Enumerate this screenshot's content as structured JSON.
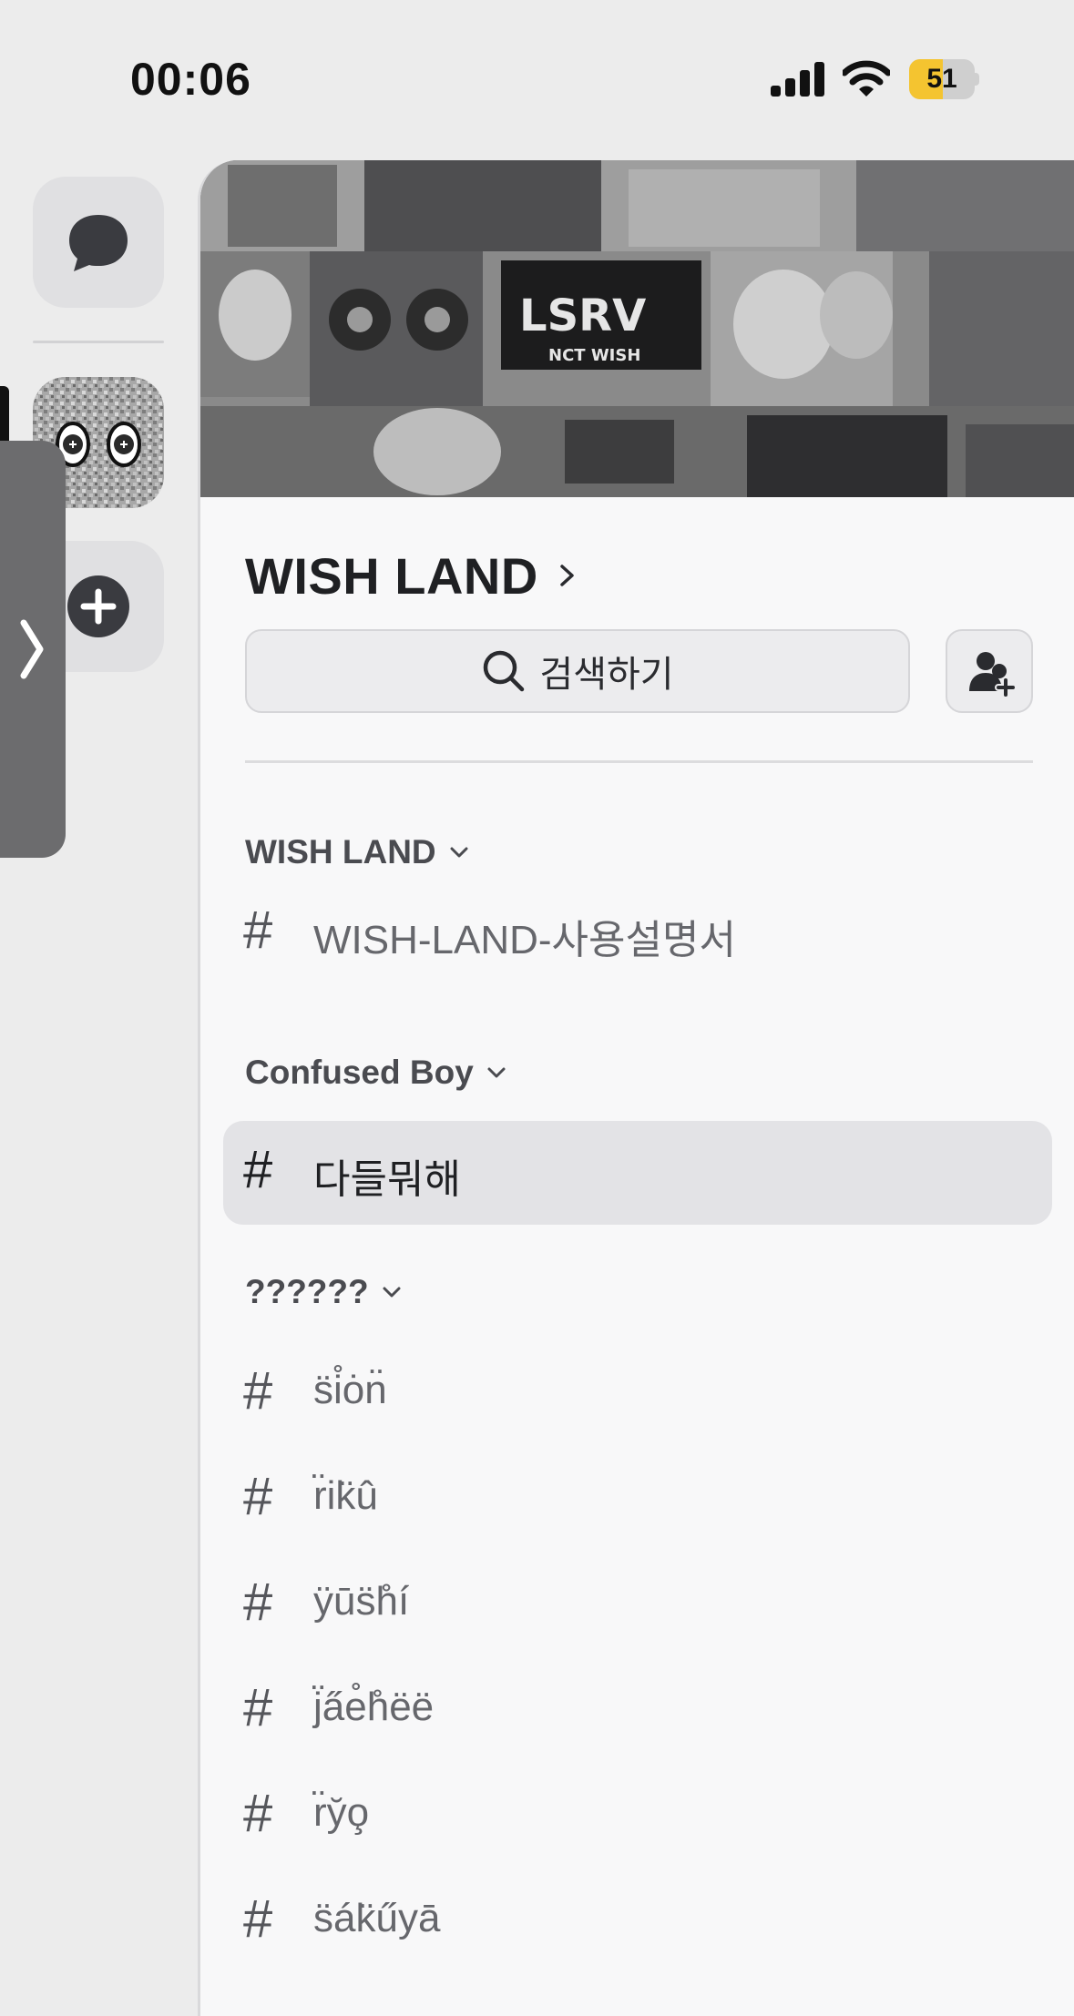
{
  "status_bar": {
    "time": "00:06",
    "battery_percent": "51",
    "battery_level": 0.51
  },
  "rail": {
    "dm_icon": "chat-bubble-icon",
    "server_icon": "server-avatar-icon",
    "add_icon": "plus-circle-icon",
    "collapse_icon": "chevron-right-icon"
  },
  "server": {
    "name": "WISH LAND",
    "banner_text": "NCT WISH"
  },
  "search": {
    "label": "검색하기"
  },
  "categories": [
    {
      "label": "WISH LAND",
      "channels": [
        {
          "name": "WISH-LAND-사용설명서"
        }
      ]
    },
    {
      "label": "Confused Boy",
      "channels": [
        {
          "name": "다들뭐해"
        }
      ]
    },
    {
      "label": "??????",
      "channels": [
        {
          "name": "s̈i̊ȯn̈"
        },
        {
          "name": "r̈ik̈û"
        },
        {
          "name": "ÿūs̈h̊í"
        },
        {
          "name": "j̈a̋e̊h̊ëë"
        },
        {
          "name": "r̈y̆o̧"
        },
        {
          "name": "s̈ák̈űyā"
        }
      ]
    }
  ],
  "hash_symbol": "#",
  "colors": {
    "accent_battery": "#f4c430",
    "active_row": "#e3e3e6"
  }
}
